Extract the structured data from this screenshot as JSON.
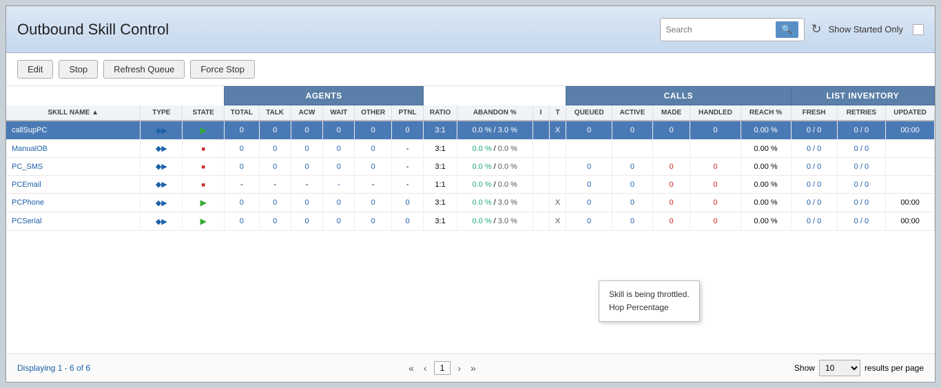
{
  "header": {
    "title": "Outbound Skill Control",
    "search_placeholder": "Search",
    "show_started_label": "Show Started Only"
  },
  "toolbar": {
    "edit_label": "Edit",
    "stop_label": "Stop",
    "refresh_queue_label": "Refresh Queue",
    "force_stop_label": "Force Stop"
  },
  "table": {
    "group_headers": {
      "agents": "AGENTS",
      "calls": "CALLS",
      "list_inventory": "LIST INVENTORY"
    },
    "columns": [
      "SKILL NAME",
      "TYPE",
      "STATE",
      "TOTAL",
      "TALK",
      "ACW",
      "WAIT",
      "OTHER",
      "PTNL",
      "RATIO",
      "ABANDON %",
      "I",
      "T",
      "QUEUED",
      "ACTIVE",
      "MADE",
      "HANDLED",
      "REACH %",
      "FRESH",
      "RETRIES",
      "UPDATED"
    ],
    "rows": [
      {
        "skill_name": "callSupPC",
        "type_icon": "◆▶",
        "state_icon": "▶",
        "state_color": "green",
        "selected": true,
        "total": "0",
        "talk": "0",
        "acw": "0",
        "wait": "0",
        "other": "0",
        "ptnl": "0",
        "ratio": "3:1",
        "abandon": "0.0 % / 3.0 %",
        "i": "",
        "t": "X",
        "queued": "0",
        "active": "0",
        "made": "0",
        "handled": "0",
        "reach": "0.00 %",
        "fresh": "0 / 0",
        "retries": "0 / 0",
        "updated": "00:00",
        "tooltip": true
      },
      {
        "skill_name": "ManualOB",
        "type_icon": "◆▶",
        "state_icon": "■",
        "state_color": "red",
        "selected": false,
        "total": "0",
        "talk": "0",
        "acw": "0",
        "wait": "0",
        "other": "0",
        "ptnl": "-",
        "ratio": "3:1",
        "abandon": "0.0 % / 0.0 %",
        "i": "",
        "t": "",
        "queued": "",
        "active": "",
        "made": "",
        "handled": "",
        "reach": "0.00 %",
        "fresh": "0 / 0",
        "retries": "0 / 0",
        "updated": "",
        "tooltip": false
      },
      {
        "skill_name": "PC_SMS",
        "type_icon": "◆▶",
        "state_icon": "■",
        "state_color": "red",
        "selected": false,
        "total": "0",
        "talk": "0",
        "acw": "0",
        "wait": "0",
        "other": "0",
        "ptnl": "-",
        "ratio": "3:1",
        "abandon": "0.0 % / 0.0 %",
        "i": "",
        "t": "",
        "queued": "0",
        "active": "0",
        "made": "0",
        "handled": "0",
        "reach": "0.00 %",
        "fresh": "0 / 0",
        "retries": "0 / 0",
        "updated": "",
        "tooltip": false
      },
      {
        "skill_name": "PCEmail",
        "type_icon": "✉",
        "state_icon": "■",
        "state_color": "red",
        "selected": false,
        "total": "-",
        "talk": "-",
        "acw": "-",
        "wait": "-",
        "other": "-",
        "ptnl": "-",
        "ratio": "1:1",
        "abandon": "0.0 % / 0.0 %",
        "i": "",
        "t": "",
        "queued": "0",
        "active": "0",
        "made": "0",
        "handled": "0",
        "reach": "0.00 %",
        "fresh": "0 / 0",
        "retries": "0 / 0",
        "updated": "",
        "tooltip": false
      },
      {
        "skill_name": "PCPhone",
        "type_icon": "◆▶",
        "state_icon": "▶",
        "state_color": "green",
        "selected": false,
        "total": "0",
        "talk": "0",
        "acw": "0",
        "wait": "0",
        "other": "0",
        "ptnl": "0",
        "ratio": "3:1",
        "abandon": "0.0 % / 3.0 %",
        "i": "",
        "t": "X",
        "queued": "0",
        "active": "0",
        "made": "0",
        "handled": "0",
        "reach": "0.00 %",
        "fresh": "0 / 0",
        "retries": "0 / 0",
        "updated": "00:00",
        "tooltip": false
      },
      {
        "skill_name": "PCSerial",
        "type_icon": "◆▶",
        "state_icon": "▶",
        "state_color": "green",
        "selected": false,
        "total": "0",
        "talk": "0",
        "acw": "0",
        "wait": "0",
        "other": "0",
        "ptnl": "0",
        "ratio": "3:1",
        "abandon": "0.0 % / 3.0 %",
        "i": "",
        "t": "X",
        "queued": "0",
        "active": "0",
        "made": "0",
        "handled": "0",
        "reach": "0.00 %",
        "fresh": "0 / 0",
        "retries": "0 / 0",
        "updated": "00:00",
        "tooltip": false
      }
    ]
  },
  "tooltip": {
    "line1": "Skill is being throttled.",
    "line2": "Hop Percentage"
  },
  "footer": {
    "display_info": "Displaying 1 - 6 of 6",
    "current_page": "1",
    "show_label": "Show",
    "results_label": "results per page",
    "per_page_value": "10"
  }
}
